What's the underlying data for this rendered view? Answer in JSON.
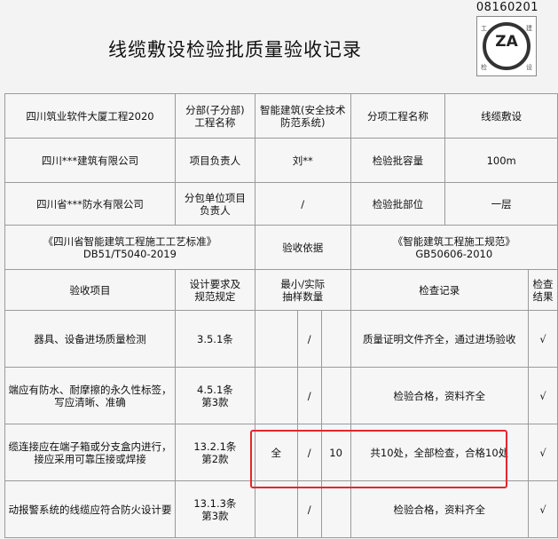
{
  "code": "08160201",
  "title": "线缆敷设检验批质量验收记录",
  "logo": {
    "text": "ZA",
    "corners": [
      "工",
      "建",
      "检",
      "设"
    ]
  },
  "header_rows": [
    {
      "left": "四川筑业软件大厦工程2020",
      "label1": "分部(子分部)\n工程名称",
      "value1": "智能建筑(安全技术\n防范系统)",
      "label2": "分项工程名称",
      "value2": "线缆敷设"
    },
    {
      "left": "四川***建筑有限公司",
      "label1": "项目负责人",
      "value1": "刘**",
      "label2": "检验批容量",
      "value2": "100m"
    },
    {
      "left": "四川省***防水有限公司",
      "label1": "分包单位项目\n负责人",
      "value1": "/",
      "label2": "检验批部位",
      "value2": "一层"
    }
  ],
  "basis": {
    "left": "《四川省智能建筑工程施工工艺标准》\nDB51/T5040-2019",
    "label": "验收依据",
    "right": "《智能建筑工程施工规范》\nGB50606-2010"
  },
  "columns": {
    "item": "验收项目",
    "spec": "设计要求及\n规范规定",
    "sample": "最小/实际\n抽样数量",
    "record": "检查记录",
    "result": "检查\n结果"
  },
  "rows": [
    {
      "item": "器具、设备进场质量检测",
      "spec": "3.5.1条",
      "min": "",
      "slash": "/",
      "actual": "",
      "record": "质量证明文件齐全，通过进场验收",
      "result": "√"
    },
    {
      "item": "端应有防水、耐摩擦的永久性标签，\n写应清晰、准确",
      "spec": "4.5.1条\n第3款",
      "min": "",
      "slash": "/",
      "actual": "",
      "record": "检验合格，资料齐全",
      "result": "√"
    },
    {
      "item": "缆连接应在端子箱或分支盒内进行，\n接应采用可靠压接或焊接",
      "spec": "13.2.1条\n第2款",
      "min": "全",
      "slash": "/",
      "actual": "10",
      "record": "共10处，全部检查，合格10处",
      "result": "√"
    },
    {
      "item": "动报警系统的线缆应符合防火设计要",
      "spec": "13.1.3条\n第3款",
      "min": "",
      "slash": "/",
      "actual": "",
      "record": "检验合格，资料齐全",
      "result": "√"
    }
  ]
}
